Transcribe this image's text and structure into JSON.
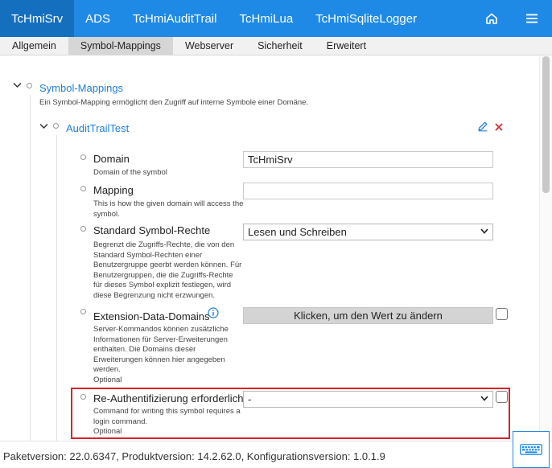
{
  "topnav": {
    "tabs": [
      {
        "label": "TcHmiSrv",
        "active": true
      },
      {
        "label": "ADS"
      },
      {
        "label": "TcHmiAuditTrail"
      },
      {
        "label": "TcHmiLua"
      },
      {
        "label": "TcHmiSqliteLogger"
      }
    ],
    "icons": [
      "home-icon",
      "menu-icon"
    ]
  },
  "subtabs": [
    {
      "label": "Allgemein"
    },
    {
      "label": "Symbol-Mappings",
      "active": true
    },
    {
      "label": "Webserver"
    },
    {
      "label": "Sicherheit"
    },
    {
      "label": "Erweitert"
    }
  ],
  "section": {
    "title": "Symbol-Mappings",
    "description": "Ein Symbol-Mapping ermöglicht den Zugriff auf interne Symbole einer Domäne."
  },
  "entry": {
    "title": "AuditTrailTest",
    "actions": [
      "edit-icon",
      "delete-icon"
    ]
  },
  "fields": {
    "domain": {
      "label": "Domain",
      "description": "Domain of the symbol",
      "value": "TcHmiSrv"
    },
    "mapping": {
      "label": "Mapping",
      "description_lines": [
        "This is how the given domain will access the",
        "symbol."
      ],
      "value": ""
    },
    "rights": {
      "label": "Standard Symbol-Rechte",
      "description_lines": [
        "Begrenzt die Zugriffs-Rechte, die von den",
        "Standard Symbol-Rechten einer",
        "Benutzergruppe geerbt werden können. Für",
        "Benutzergruppen, die die Zugriffs-Rechte",
        "für dieses Symbol explizit festlegen, wird",
        "diese Begrenzung nicht erzwungen."
      ],
      "value": "Lesen und Schreiben"
    },
    "extension": {
      "label": "Extension-Data-Domains",
      "description_lines": [
        "Server-Kommandos können zusätzliche",
        "Informationen für Server-Erweiterungen",
        "enthalten. Die Domains dieser",
        "Erweiterungen können hier angegeben",
        "werden."
      ],
      "optional": "Optional",
      "button": "Klicken, um den Wert zu ändern",
      "icon": "info-icon"
    },
    "reauth": {
      "label": "Re-Authentifizierung erforderlich",
      "description_lines": [
        "Command for writing this symbol requires a",
        "login command."
      ],
      "optional": "Optional",
      "value": "-"
    }
  },
  "footer": {
    "version_text": "Paketversion: 22.0.6347, Produktversion: 14.2.62.0, Konfigurationsversion: 1.0.1.9",
    "icon": "keyboard-icon"
  },
  "colors": {
    "accent": "#1f8ae6",
    "accent_dark": "#156fbf",
    "highlight": "#d8232a",
    "delete": "#d32f2f"
  }
}
